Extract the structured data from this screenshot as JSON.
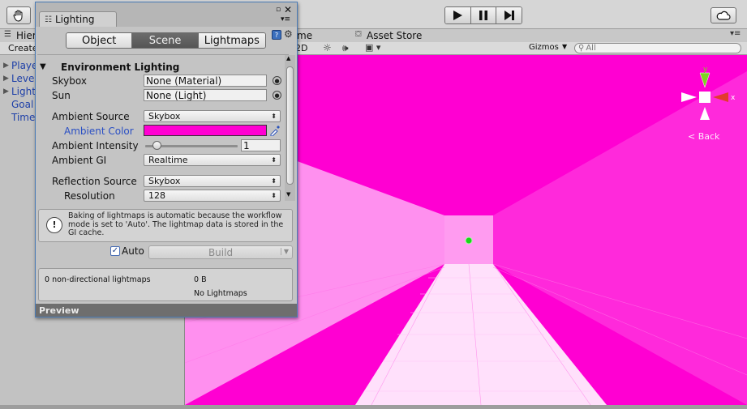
{
  "toolbar": {
    "hand_icon": "hand-icon",
    "play_icon": "play-icon",
    "pause_icon": "pause-icon",
    "step_icon": "step-icon",
    "cloud_icon": "cloud-icon"
  },
  "hierarchy": {
    "tab_label": "Hier",
    "create_label": "Create",
    "items": [
      {
        "label": "Playe",
        "expandable": true
      },
      {
        "label": "Leve",
        "expandable": true
      },
      {
        "label": "Light",
        "expandable": true
      },
      {
        "label": "Goal",
        "expandable": false
      },
      {
        "label": "Time",
        "expandable": false
      }
    ]
  },
  "scene": {
    "tab_game_partial": "me",
    "tab_asset_store": "Asset Store",
    "mode_2d": "2D",
    "gizmos_label": "Gizmos",
    "search_placeholder": "All",
    "back_label": "Back",
    "axis_y": "y",
    "axis_x": "x",
    "background_color": "#ff00d2"
  },
  "lighting": {
    "title": "Lighting",
    "tabs": [
      "Object",
      "Scene",
      "Lightmaps"
    ],
    "active_tab": "Scene",
    "section_title": "Environment Lighting",
    "skybox_label": "Skybox",
    "skybox_value": "None (Material)",
    "sun_label": "Sun",
    "sun_value": "None (Light)",
    "ambient_source_label": "Ambient Source",
    "ambient_source_value": "Skybox",
    "ambient_color_label": "Ambient Color",
    "ambient_color_value": "#ff00d2",
    "ambient_intensity_label": "Ambient Intensity",
    "ambient_intensity_value": "1",
    "ambient_intensity_fraction": 0.125,
    "ambient_gi_label": "Ambient GI",
    "ambient_gi_value": "Realtime",
    "reflection_source_label": "Reflection Source",
    "reflection_source_value": "Skybox",
    "resolution_label": "Resolution",
    "resolution_value": "128",
    "help_text": "Baking of lightmaps is automatic because the workflow mode is set to 'Auto'. The lightmap data is stored in the GI cache.",
    "auto_label": "Auto",
    "auto_checked": true,
    "build_label": "Build",
    "stats_lightmaps": "0 non-directional lightmaps",
    "stats_size": "0 B",
    "stats_none": "No Lightmaps",
    "preview_label": "Preview"
  }
}
